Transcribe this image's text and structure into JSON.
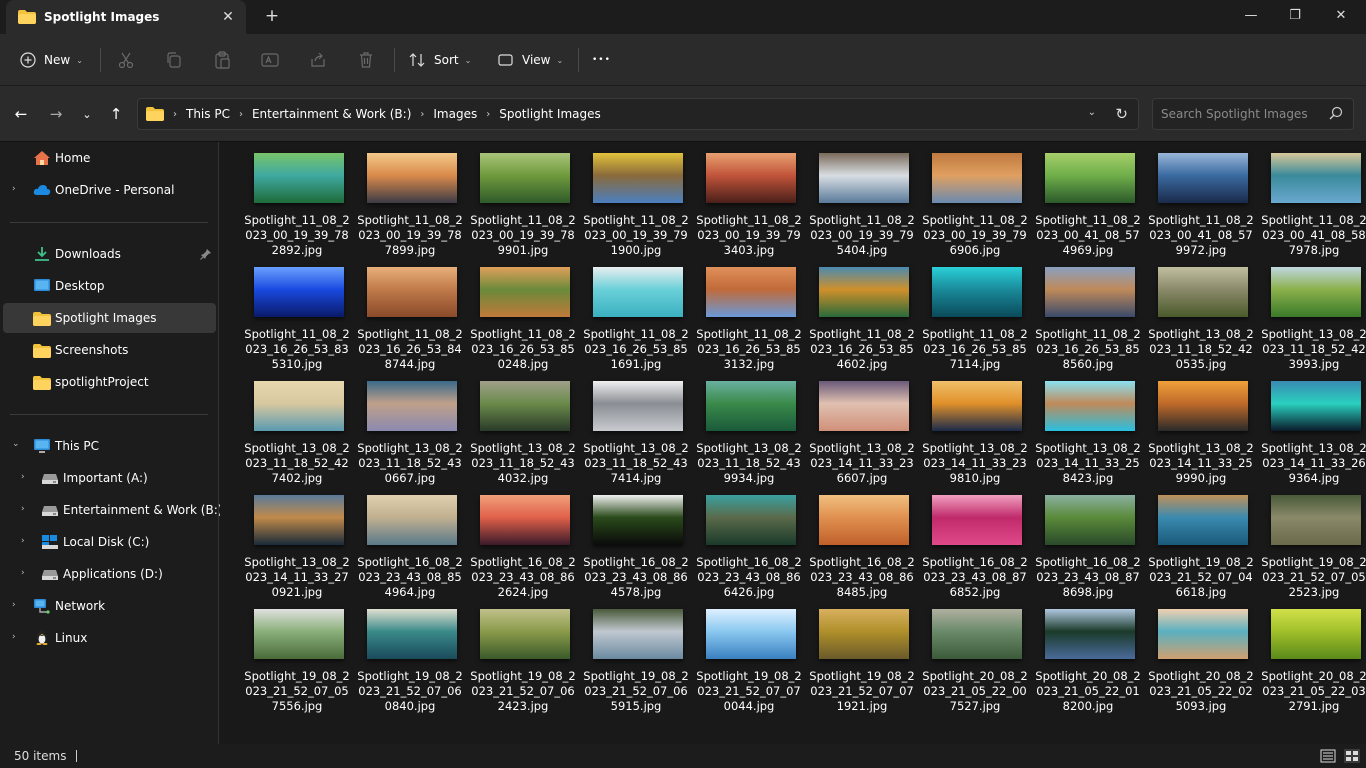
{
  "window": {
    "tab_title": "Spotlight Images",
    "tab_close": "✕",
    "new_tab": "+",
    "minimize": "—",
    "maximize": "❐",
    "close": "✕"
  },
  "toolbar": {
    "new_label": "New",
    "sort_label": "Sort",
    "view_label": "View",
    "more_label": "•••",
    "caret": "⌄"
  },
  "nav": {
    "back": "←",
    "forward": "→",
    "recent": "⌄",
    "up": "↑"
  },
  "address": {
    "breadcrumbs": [
      "This PC",
      "Entertainment & Work (B:)",
      "Images",
      "Spotlight Images"
    ],
    "chevron": "›",
    "dropdown": "⌄",
    "refresh": "↻"
  },
  "search": {
    "placeholder": "Search Spotlight Images"
  },
  "sidebar": {
    "quick": [
      {
        "label": "Home",
        "icon": "home-icon"
      },
      {
        "label": "OneDrive - Personal",
        "icon": "cloud-icon"
      }
    ],
    "pinned": [
      {
        "label": "Downloads",
        "icon": "download-icon"
      },
      {
        "label": "Desktop",
        "icon": "desktop-icon"
      },
      {
        "label": "Spotlight Images",
        "icon": "folder-icon"
      },
      {
        "label": "Screenshots",
        "icon": "folder-icon"
      },
      {
        "label": "spotlightProject",
        "icon": "folder-icon"
      }
    ],
    "this_pc": "This PC",
    "drives": [
      {
        "label": "Important (A:)",
        "icon": "drive-icon"
      },
      {
        "label": "Entertainment & Work (B:)",
        "icon": "drive-icon"
      },
      {
        "label": "Local Disk (C:)",
        "icon": "windows-drive-icon"
      },
      {
        "label": "Applications (D:)",
        "icon": "drive-icon"
      }
    ],
    "network": "Network",
    "linux": "Linux",
    "expand_closed": "›",
    "expand_open": "⌄"
  },
  "files": [
    "Spotlight_11_08_2023_00_19_39_782892.jpg",
    "Spotlight_11_08_2023_00_19_39_787899.jpg",
    "Spotlight_11_08_2023_00_19_39_789901.jpg",
    "Spotlight_11_08_2023_00_19_39_791900.jpg",
    "Spotlight_11_08_2023_00_19_39_793403.jpg",
    "Spotlight_11_08_2023_00_19_39_795404.jpg",
    "Spotlight_11_08_2023_00_19_39_796906.jpg",
    "Spotlight_11_08_2023_00_41_08_574969.jpg",
    "Spotlight_11_08_2023_00_41_08_579972.jpg",
    "Spotlight_11_08_2023_00_41_08_587978.jpg",
    "Spotlight_11_08_2023_16_26_53_835310.jpg",
    "Spotlight_11_08_2023_16_26_53_848744.jpg",
    "Spotlight_11_08_2023_16_26_53_850248.jpg",
    "Spotlight_11_08_2023_16_26_53_851691.jpg",
    "Spotlight_11_08_2023_16_26_53_853132.jpg",
    "Spotlight_11_08_2023_16_26_53_854602.jpg",
    "Spotlight_11_08_2023_16_26_53_857114.jpg",
    "Spotlight_11_08_2023_16_26_53_858560.jpg",
    "Spotlight_13_08_2023_11_18_52_420535.jpg",
    "Spotlight_13_08_2023_11_18_52_423993.jpg",
    "Spotlight_13_08_2023_11_18_52_427402.jpg",
    "Spotlight_13_08_2023_11_18_52_430667.jpg",
    "Spotlight_13_08_2023_11_18_52_434032.jpg",
    "Spotlight_13_08_2023_11_18_52_437414.jpg",
    "Spotlight_13_08_2023_11_18_52_439934.jpg",
    "Spotlight_13_08_2023_14_11_33_236607.jpg",
    "Spotlight_13_08_2023_14_11_33_239810.jpg",
    "Spotlight_13_08_2023_14_11_33_258423.jpg",
    "Spotlight_13_08_2023_14_11_33_259990.jpg",
    "Spotlight_13_08_2023_14_11_33_269364.jpg",
    "Spotlight_13_08_2023_14_11_33_270921.jpg",
    "Spotlight_16_08_2023_23_43_08_854964.jpg",
    "Spotlight_16_08_2023_23_43_08_862624.jpg",
    "Spotlight_16_08_2023_23_43_08_864578.jpg",
    "Spotlight_16_08_2023_23_43_08_866426.jpg",
    "Spotlight_16_08_2023_23_43_08_868485.jpg",
    "Spotlight_16_08_2023_23_43_08_876852.jpg",
    "Spotlight_16_08_2023_23_43_08_878698.jpg",
    "Spotlight_19_08_2023_21_52_07_046618.jpg",
    "Spotlight_19_08_2023_21_52_07_052523.jpg",
    "Spotlight_19_08_2023_21_52_07_057556.jpg",
    "Spotlight_19_08_2023_21_52_07_060840.jpg",
    "Spotlight_19_08_2023_21_52_07_062423.jpg",
    "Spotlight_19_08_2023_21_52_07_065915.jpg",
    "Spotlight_19_08_2023_21_52_07_070044.jpg",
    "Spotlight_19_08_2023_21_52_07_071921.jpg",
    "Spotlight_20_08_2023_21_05_22_007527.jpg",
    "Spotlight_20_08_2023_21_05_22_018200.jpg",
    "Spotlight_20_08_2023_21_05_22_025093.jpg",
    "Spotlight_20_08_2023_21_05_22_032791.jpg"
  ],
  "thumbnails": [
    [
      "#1f6b3a",
      "#3fa9a0",
      "#78c46a"
    ],
    [
      "#3c3a46",
      "#d98a4a",
      "#f3c98a"
    ],
    [
      "#2f5a2a",
      "#6f9a3c",
      "#a8c47a"
    ],
    [
      "#4b7fc0",
      "#8a6a3a",
      "#e2c23a"
    ],
    [
      "#4a1f1a",
      "#c0543a",
      "#e8a070"
    ],
    [
      "#5a7a9a",
      "#d8dde2",
      "#7a6a5a"
    ],
    [
      "#6a8ab0",
      "#e0a060",
      "#c07a40"
    ],
    [
      "#2c5a2a",
      "#6fae4a",
      "#a6cf6a"
    ],
    [
      "#1a2a4a",
      "#3a6aa0",
      "#9ab6d8"
    ],
    [
      "#6aa8d0",
      "#3a8a9a",
      "#d8c89a"
    ],
    [
      "#0a1a6a",
      "#1a4ae0",
      "#6aa0ff"
    ],
    [
      "#8a4a2a",
      "#c07a4a",
      "#e8b07a"
    ],
    [
      "#c07a3a",
      "#6a8a3a",
      "#e0a05a"
    ],
    [
      "#3ab0c0",
      "#6ad0d8",
      "#e8eef0"
    ],
    [
      "#6a9ad8",
      "#c06a3a",
      "#e0905a"
    ],
    [
      "#2a6a3a",
      "#d0902a",
      "#4a8ab0"
    ],
    [
      "#0a4a5a",
      "#1a8a9a",
      "#2ad0d8"
    ],
    [
      "#3a4a6a",
      "#c08a5a",
      "#8aa0c0"
    ],
    [
      "#4a5a2a",
      "#8a8a6a",
      "#c0c0a0"
    ],
    [
      "#3a7a2a",
      "#8ab04a",
      "#c0d8e0"
    ],
    [
      "#5a9ab0",
      "#d8c8a0",
      "#e8d8b0"
    ],
    [
      "#8a8ab0",
      "#c0a08a",
      "#3a6a8a"
    ],
    [
      "#2a3a2a",
      "#6a8a4a",
      "#a0a08a"
    ],
    [
      "#c8ccd0",
      "#8a8e94",
      "#f0f0f0"
    ],
    [
      "#1a5a3a",
      "#3a8a4a",
      "#6ab0a0"
    ],
    [
      "#d0907a",
      "#e0c0b0",
      "#6a5a7a"
    ],
    [
      "#1a2a4a",
      "#e0902a",
      "#f0c06a"
    ],
    [
      "#2ac0e0",
      "#c08a5a",
      "#8ae0f0"
    ],
    [
      "#2a2a2a",
      "#c06a2a",
      "#f0a03a"
    ],
    [
      "#0a1a2a",
      "#2ad0c0",
      "#3a8ab0"
    ],
    [
      "#1a2a3a",
      "#c08a4a",
      "#5a7a9a"
    ],
    [
      "#5a7a8a",
      "#c0b090",
      "#e0d0b0"
    ],
    [
      "#3a1a2a",
      "#e0604a",
      "#f0a07a"
    ],
    [
      "#0a0a0a",
      "#2a4a1a",
      "#f0f0f0"
    ],
    [
      "#1a3a2a",
      "#5a6a4a",
      "#3aa0a0"
    ],
    [
      "#c0602a",
      "#e09050",
      "#f0c080"
    ],
    [
      "#e04a8a",
      "#c02a6a",
      "#f0a0c0"
    ],
    [
      "#2a4a2a",
      "#5a8a3a",
      "#8ab0a0"
    ],
    [
      "#1a5a7a",
      "#3a8ab0",
      "#c0905a"
    ],
    [
      "#6a6a4a",
      "#8a8a6a",
      "#4a5a3a"
    ],
    [
      "#4a6a3a",
      "#8ab07a",
      "#e0e0e0"
    ],
    [
      "#1a4a5a",
      "#3a8a8a",
      "#e0e0d0"
    ],
    [
      "#3a5a2a",
      "#8a9a4a",
      "#c0c08a"
    ],
    [
      "#6a8aa0",
      "#c0c8d0",
      "#4a5a3a"
    ],
    [
      "#3a80c0",
      "#8ac8f0",
      "#dff0ff"
    ],
    [
      "#6a5a2a",
      "#b0902a",
      "#d8b060"
    ],
    [
      "#3a5a3a",
      "#6a8a6a",
      "#b0b0a0"
    ],
    [
      "#4a6a9a",
      "#1a3a2a",
      "#b0c8e0"
    ],
    [
      "#d0a070",
      "#5ab0c0",
      "#f0d0b0"
    ],
    [
      "#5a8a1a",
      "#a0c02a",
      "#d0e04a"
    ]
  ],
  "status": {
    "item_count": "50 items"
  }
}
